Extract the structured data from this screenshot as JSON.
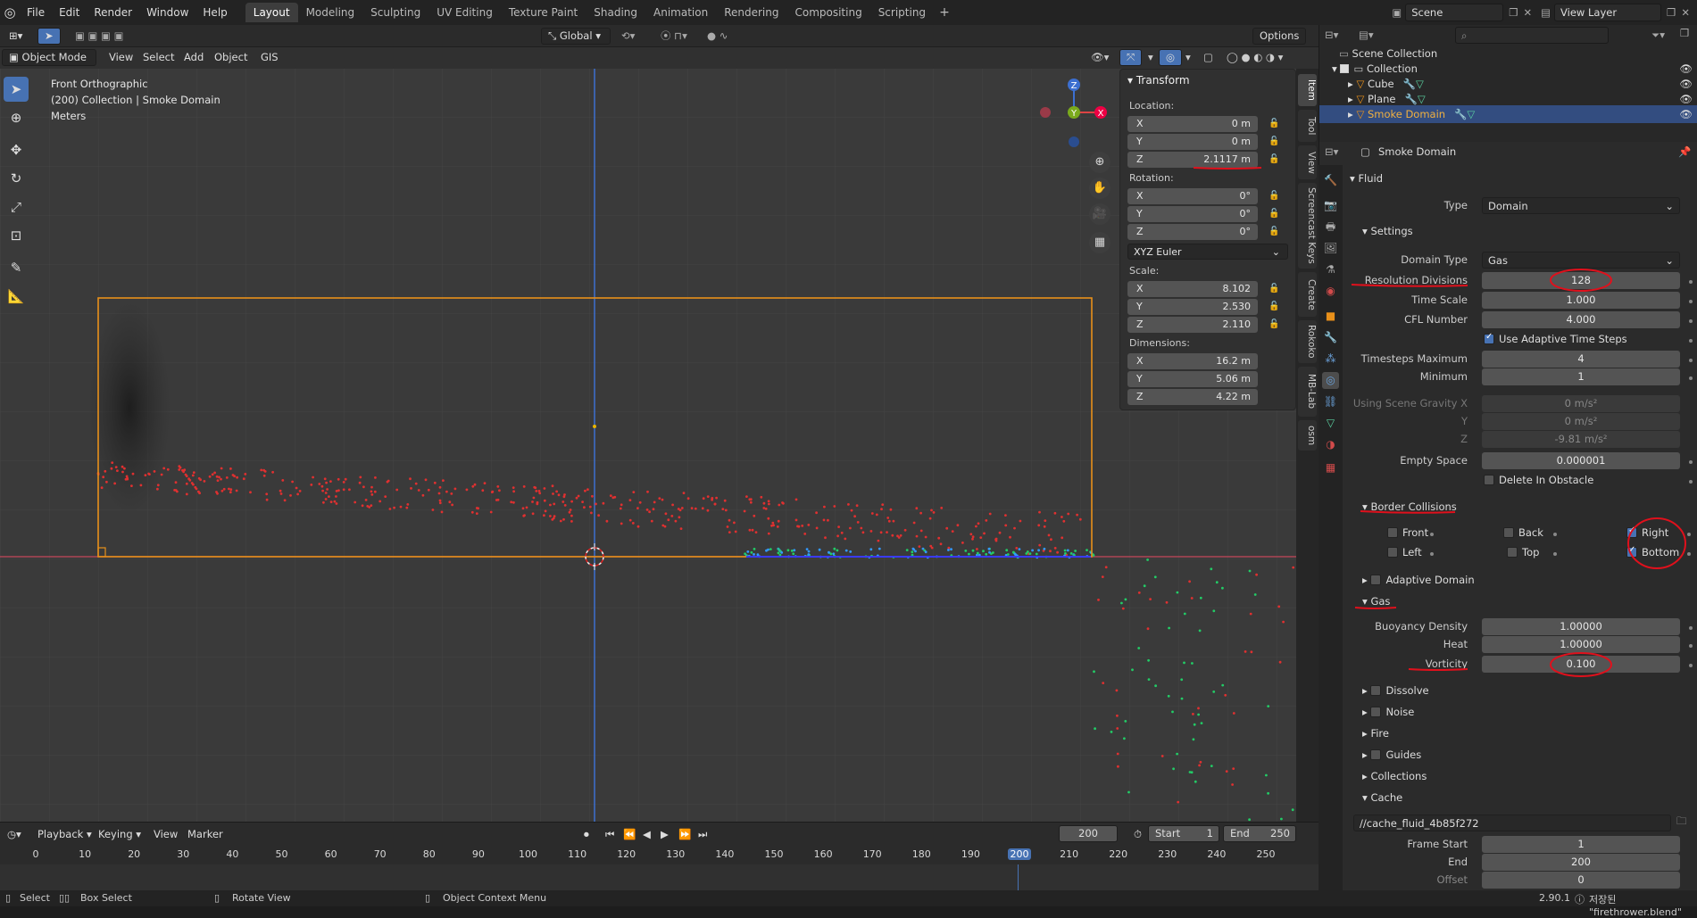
{
  "menubar": {
    "items": [
      "File",
      "Edit",
      "Render",
      "Window",
      "Help"
    ],
    "workspaces": [
      "Layout",
      "Modeling",
      "Sculpting",
      "UV Editing",
      "Texture Paint",
      "Shading",
      "Animation",
      "Rendering",
      "Compositing",
      "Scripting"
    ],
    "active_workspace": "Layout",
    "scene_label": "Scene",
    "view_layer_label": "View Layer"
  },
  "viewport_header": {
    "mode": "Object Mode",
    "menus": [
      "View",
      "Select",
      "Add",
      "Object",
      "GIS"
    ],
    "transform_orientation": "Global",
    "options_label": "Options"
  },
  "viewport": {
    "view_name": "Front Orthographic",
    "collection_info": "(200) Collection | Smoke Domain",
    "units": "Meters"
  },
  "npanel": {
    "title": "Transform",
    "location_label": "Location:",
    "location": [
      {
        "axis": "X",
        "value": "0 m"
      },
      {
        "axis": "Y",
        "value": "0 m"
      },
      {
        "axis": "Z",
        "value": "2.1117 m"
      }
    ],
    "rotation_label": "Rotation:",
    "rotation": [
      {
        "axis": "X",
        "value": "0°"
      },
      {
        "axis": "Y",
        "value": "0°"
      },
      {
        "axis": "Z",
        "value": "0°"
      }
    ],
    "rotation_mode": "XYZ Euler",
    "scale_label": "Scale:",
    "scale": [
      {
        "axis": "X",
        "value": "8.102"
      },
      {
        "axis": "Y",
        "value": "2.530"
      },
      {
        "axis": "Z",
        "value": "2.110"
      }
    ],
    "dimensions_label": "Dimensions:",
    "dimensions": [
      {
        "axis": "X",
        "value": "16.2 m"
      },
      {
        "axis": "Y",
        "value": "5.06 m"
      },
      {
        "axis": "Z",
        "value": "4.22 m"
      }
    ],
    "tabs": [
      "Item",
      "Tool",
      "View",
      "Screencast Keys",
      "Create",
      "Rokoko",
      "MB-Lab",
      "osm"
    ],
    "active_tab": "Item"
  },
  "outliner": {
    "root": "Scene Collection",
    "collection": "Collection",
    "objects": [
      "Cube",
      "Plane",
      "Smoke Domain"
    ],
    "selected": "Smoke Domain"
  },
  "properties": {
    "object_name": "Smoke Domain",
    "panel": "Fluid",
    "type_label": "Type",
    "type_value": "Domain",
    "settings_label": "Settings",
    "domain_type_label": "Domain Type",
    "domain_type_value": "Gas",
    "resolution_label": "Resolution Divisions",
    "resolution_value": "128",
    "time_scale_label": "Time Scale",
    "time_scale_value": "1.000",
    "cfl_label": "CFL Number",
    "cfl_value": "4.000",
    "adaptive_ts_label": "Use Adaptive Time Steps",
    "ts_max_label": "Timesteps Maximum",
    "ts_max_value": "4",
    "ts_min_label": "Minimum",
    "ts_min_value": "1",
    "gravity_x_label": "Using Scene Gravity X",
    "gravity_x_value": "0 m/s²",
    "gravity_y_label": "Y",
    "gravity_y_value": "0 m/s²",
    "gravity_z_label": "Z",
    "gravity_z_value": "-9.81 m/s²",
    "empty_space_label": "Empty Space",
    "empty_space_value": "0.000001",
    "delete_obstacle_label": "Delete In Obstacle",
    "border_label": "Border Collisions",
    "border_front": "Front",
    "border_back": "Back",
    "border_right": "Right",
    "border_left": "Left",
    "border_top": "Top",
    "border_bottom": "Bottom",
    "adaptive_domain_label": "Adaptive Domain",
    "gas_label": "Gas",
    "buoyancy_label": "Buoyancy Density",
    "buoyancy_value": "1.00000",
    "heat_label": "Heat",
    "heat_value": "1.00000",
    "vorticity_label": "Vorticity",
    "vorticity_value": "0.100",
    "dissolve_label": "Dissolve",
    "noise_label": "Noise",
    "fire_label": "Fire",
    "guides_label": "Guides",
    "collections_label": "Collections",
    "cache_label": "Cache",
    "cache_path": "//cache_fluid_4b85f272",
    "frame_start_label": "Frame Start",
    "frame_start_value": "1",
    "frame_end_label": "End",
    "frame_end_value": "200",
    "offset_label": "Offset",
    "offset_value": "0"
  },
  "timeline": {
    "menus": [
      "Playback",
      "Keying",
      "View",
      "Marker"
    ],
    "current_frame": "200",
    "start_label": "Start",
    "start_value": "1",
    "end_label": "End",
    "end_value": "250",
    "ruler_ticks": [
      "0",
      "10",
      "20",
      "30",
      "40",
      "50",
      "60",
      "70",
      "80",
      "90",
      "100",
      "110",
      "120",
      "130",
      "140",
      "150",
      "160",
      "170",
      "180",
      "190",
      "200",
      "210",
      "220",
      "230",
      "240",
      "250"
    ]
  },
  "statusbar": {
    "select": "Select",
    "box_select": "Box Select",
    "rotate_view": "Rotate View",
    "context_menu": "Object Context Menu",
    "version": "2.90.1",
    "saved_msg": "저장된 \"firethrower.blend\""
  },
  "colors": {
    "accent": "#4772b3",
    "annotation": "#e0101c",
    "domain_outline": "#e8901a"
  }
}
